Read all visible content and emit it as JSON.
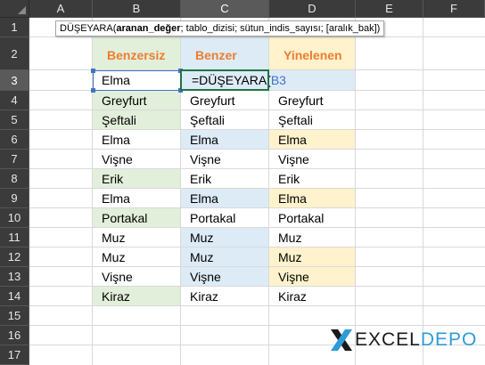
{
  "columns": [
    "A",
    "B",
    "C",
    "D",
    "E",
    "F"
  ],
  "active_column": "C",
  "rows": [
    "1",
    "2",
    "3",
    "4",
    "5",
    "6",
    "7",
    "8",
    "9",
    "10",
    "11",
    "12",
    "13",
    "14",
    "15",
    "16",
    "17"
  ],
  "active_row": "3",
  "tooltip": {
    "fn_name": "DÜŞEYARA(",
    "arg_bold": "aranan_değer",
    "rest": "; tablo_dizisi; sütun_indis_sayısı; [aralık_bak])"
  },
  "headers": {
    "b": "Benzersiz",
    "c": "Benzer",
    "d": "Yinelenen"
  },
  "editing": {
    "formula_text": "=DÜŞEYARA(",
    "formula_ref": "B3"
  },
  "table": {
    "b": [
      "Elma",
      "Greyfurt",
      "Şeftali",
      "Elma",
      "Vişne",
      "Erik",
      "Elma",
      "Portakal",
      "Muz",
      "Muz",
      "Vişne",
      "Kiraz"
    ],
    "c": [
      "",
      "Greyfurt",
      "Şeftali",
      "Elma",
      "Vişne",
      "Erik",
      "Elma",
      "Portakal",
      "Muz",
      "Muz",
      "Vişne",
      "Kiraz"
    ],
    "d": [
      "",
      "Greyfurt",
      "Şeftali",
      "Elma",
      "Vişne",
      "Erik",
      "Elma",
      "Portakal",
      "Muz",
      "Muz",
      "Vişne",
      "Kiraz"
    ]
  },
  "fills": {
    "b": [
      "none",
      "green",
      "green",
      "none",
      "none",
      "green",
      "none",
      "green",
      "none",
      "none",
      "none",
      "green"
    ],
    "c": [
      "blue",
      "none",
      "none",
      "blue",
      "none",
      "none",
      "blue",
      "none",
      "blue",
      "blue",
      "blue",
      "none"
    ],
    "d": [
      "none",
      "none",
      "none",
      "yellow",
      "none",
      "none",
      "yellow",
      "none",
      "none",
      "yellow",
      "yellow",
      "none"
    ]
  },
  "colors": {
    "header_text": "#ed7d31",
    "green_fill": "#e2efda",
    "blue_fill": "#ddebf7",
    "yellow_fill": "#fff2cc",
    "active_border": "#217346",
    "ref_color": "#4472c4"
  },
  "logo": {
    "icon": "x-mark-icon",
    "excel": "EXCEL",
    "depo": "DEPO"
  }
}
